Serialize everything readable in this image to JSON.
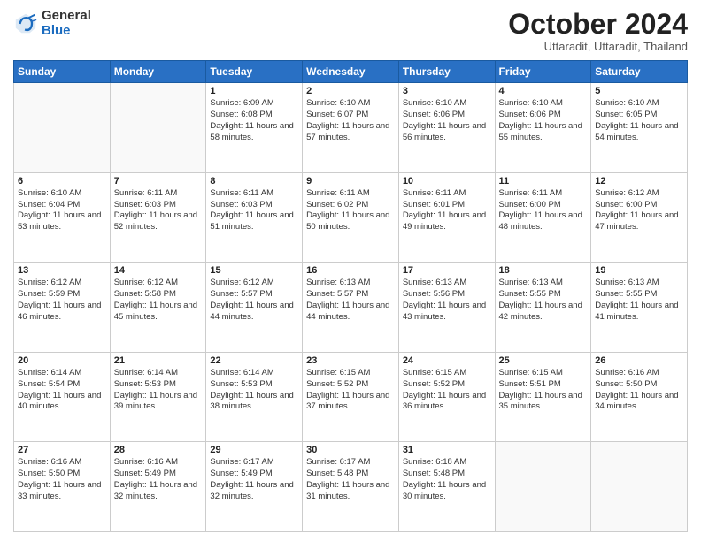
{
  "logo": {
    "general": "General",
    "blue": "Blue"
  },
  "header": {
    "month": "October 2024",
    "location": "Uttaradit, Uttaradit, Thailand"
  },
  "weekdays": [
    "Sunday",
    "Monday",
    "Tuesday",
    "Wednesday",
    "Thursday",
    "Friday",
    "Saturday"
  ],
  "weeks": [
    [
      {
        "day": "",
        "sunrise": "",
        "sunset": "",
        "daylight": ""
      },
      {
        "day": "",
        "sunrise": "",
        "sunset": "",
        "daylight": ""
      },
      {
        "day": "1",
        "sunrise": "Sunrise: 6:09 AM",
        "sunset": "Sunset: 6:08 PM",
        "daylight": "Daylight: 11 hours and 58 minutes."
      },
      {
        "day": "2",
        "sunrise": "Sunrise: 6:10 AM",
        "sunset": "Sunset: 6:07 PM",
        "daylight": "Daylight: 11 hours and 57 minutes."
      },
      {
        "day": "3",
        "sunrise": "Sunrise: 6:10 AM",
        "sunset": "Sunset: 6:06 PM",
        "daylight": "Daylight: 11 hours and 56 minutes."
      },
      {
        "day": "4",
        "sunrise": "Sunrise: 6:10 AM",
        "sunset": "Sunset: 6:06 PM",
        "daylight": "Daylight: 11 hours and 55 minutes."
      },
      {
        "day": "5",
        "sunrise": "Sunrise: 6:10 AM",
        "sunset": "Sunset: 6:05 PM",
        "daylight": "Daylight: 11 hours and 54 minutes."
      }
    ],
    [
      {
        "day": "6",
        "sunrise": "Sunrise: 6:10 AM",
        "sunset": "Sunset: 6:04 PM",
        "daylight": "Daylight: 11 hours and 53 minutes."
      },
      {
        "day": "7",
        "sunrise": "Sunrise: 6:11 AM",
        "sunset": "Sunset: 6:03 PM",
        "daylight": "Daylight: 11 hours and 52 minutes."
      },
      {
        "day": "8",
        "sunrise": "Sunrise: 6:11 AM",
        "sunset": "Sunset: 6:03 PM",
        "daylight": "Daylight: 11 hours and 51 minutes."
      },
      {
        "day": "9",
        "sunrise": "Sunrise: 6:11 AM",
        "sunset": "Sunset: 6:02 PM",
        "daylight": "Daylight: 11 hours and 50 minutes."
      },
      {
        "day": "10",
        "sunrise": "Sunrise: 6:11 AM",
        "sunset": "Sunset: 6:01 PM",
        "daylight": "Daylight: 11 hours and 49 minutes."
      },
      {
        "day": "11",
        "sunrise": "Sunrise: 6:11 AM",
        "sunset": "Sunset: 6:00 PM",
        "daylight": "Daylight: 11 hours and 48 minutes."
      },
      {
        "day": "12",
        "sunrise": "Sunrise: 6:12 AM",
        "sunset": "Sunset: 6:00 PM",
        "daylight": "Daylight: 11 hours and 47 minutes."
      }
    ],
    [
      {
        "day": "13",
        "sunrise": "Sunrise: 6:12 AM",
        "sunset": "Sunset: 5:59 PM",
        "daylight": "Daylight: 11 hours and 46 minutes."
      },
      {
        "day": "14",
        "sunrise": "Sunrise: 6:12 AM",
        "sunset": "Sunset: 5:58 PM",
        "daylight": "Daylight: 11 hours and 45 minutes."
      },
      {
        "day": "15",
        "sunrise": "Sunrise: 6:12 AM",
        "sunset": "Sunset: 5:57 PM",
        "daylight": "Daylight: 11 hours and 44 minutes."
      },
      {
        "day": "16",
        "sunrise": "Sunrise: 6:13 AM",
        "sunset": "Sunset: 5:57 PM",
        "daylight": "Daylight: 11 hours and 44 minutes."
      },
      {
        "day": "17",
        "sunrise": "Sunrise: 6:13 AM",
        "sunset": "Sunset: 5:56 PM",
        "daylight": "Daylight: 11 hours and 43 minutes."
      },
      {
        "day": "18",
        "sunrise": "Sunrise: 6:13 AM",
        "sunset": "Sunset: 5:55 PM",
        "daylight": "Daylight: 11 hours and 42 minutes."
      },
      {
        "day": "19",
        "sunrise": "Sunrise: 6:13 AM",
        "sunset": "Sunset: 5:55 PM",
        "daylight": "Daylight: 11 hours and 41 minutes."
      }
    ],
    [
      {
        "day": "20",
        "sunrise": "Sunrise: 6:14 AM",
        "sunset": "Sunset: 5:54 PM",
        "daylight": "Daylight: 11 hours and 40 minutes."
      },
      {
        "day": "21",
        "sunrise": "Sunrise: 6:14 AM",
        "sunset": "Sunset: 5:53 PM",
        "daylight": "Daylight: 11 hours and 39 minutes."
      },
      {
        "day": "22",
        "sunrise": "Sunrise: 6:14 AM",
        "sunset": "Sunset: 5:53 PM",
        "daylight": "Daylight: 11 hours and 38 minutes."
      },
      {
        "day": "23",
        "sunrise": "Sunrise: 6:15 AM",
        "sunset": "Sunset: 5:52 PM",
        "daylight": "Daylight: 11 hours and 37 minutes."
      },
      {
        "day": "24",
        "sunrise": "Sunrise: 6:15 AM",
        "sunset": "Sunset: 5:52 PM",
        "daylight": "Daylight: 11 hours and 36 minutes."
      },
      {
        "day": "25",
        "sunrise": "Sunrise: 6:15 AM",
        "sunset": "Sunset: 5:51 PM",
        "daylight": "Daylight: 11 hours and 35 minutes."
      },
      {
        "day": "26",
        "sunrise": "Sunrise: 6:16 AM",
        "sunset": "Sunset: 5:50 PM",
        "daylight": "Daylight: 11 hours and 34 minutes."
      }
    ],
    [
      {
        "day": "27",
        "sunrise": "Sunrise: 6:16 AM",
        "sunset": "Sunset: 5:50 PM",
        "daylight": "Daylight: 11 hours and 33 minutes."
      },
      {
        "day": "28",
        "sunrise": "Sunrise: 6:16 AM",
        "sunset": "Sunset: 5:49 PM",
        "daylight": "Daylight: 11 hours and 32 minutes."
      },
      {
        "day": "29",
        "sunrise": "Sunrise: 6:17 AM",
        "sunset": "Sunset: 5:49 PM",
        "daylight": "Daylight: 11 hours and 32 minutes."
      },
      {
        "day": "30",
        "sunrise": "Sunrise: 6:17 AM",
        "sunset": "Sunset: 5:48 PM",
        "daylight": "Daylight: 11 hours and 31 minutes."
      },
      {
        "day": "31",
        "sunrise": "Sunrise: 6:18 AM",
        "sunset": "Sunset: 5:48 PM",
        "daylight": "Daylight: 11 hours and 30 minutes."
      },
      {
        "day": "",
        "sunrise": "",
        "sunset": "",
        "daylight": ""
      },
      {
        "day": "",
        "sunrise": "",
        "sunset": "",
        "daylight": ""
      }
    ]
  ]
}
